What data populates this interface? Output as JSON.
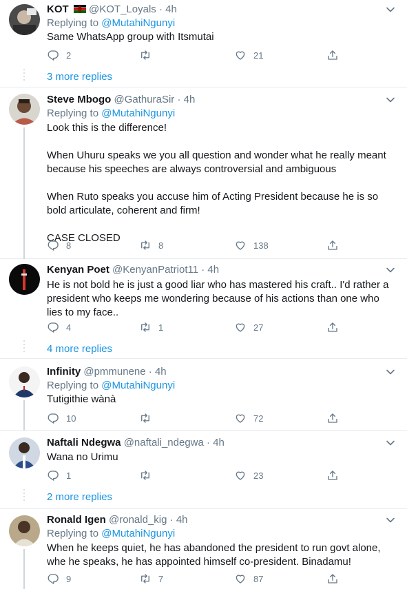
{
  "colors": {
    "link": "#1b95e0",
    "muted": "#657786",
    "text": "#14171a",
    "border": "#e6ecf0"
  },
  "icons": {
    "reply": "reply-icon",
    "retweet": "retweet-icon",
    "like": "heart-icon",
    "share": "share-icon",
    "more": "chevron-down-icon"
  },
  "tweets": [
    {
      "name": "KOT",
      "flag": "kenya-flag-icon",
      "handle": "@KOT_Loyals",
      "dot": "·",
      "time": "4h",
      "replying_prefix": "Replying to ",
      "replying_to": "@MutahiNgunyi",
      "text": "Same WhatsApp group with Itsmutai",
      "replies": "2",
      "retweets": "",
      "likes": "21",
      "more_replies": "3 more replies"
    },
    {
      "name": "Steve Mbogo",
      "handle": "@GathuraSir",
      "dot": "·",
      "time": "4h",
      "replying_prefix": "Replying to ",
      "replying_to": "@MutahiNgunyi",
      "text": "Look this is the difference!\n\nWhen Uhuru speaks we you all question and wonder what he really meant because his speeches are always controversial and ambiguous\n\nWhen Ruto speaks you accuse him of Acting President because he is so bold articulate, coherent and firm!\n\nCASE CLOSED",
      "replies": "8",
      "retweets": "8",
      "likes": "138"
    },
    {
      "name": "Kenyan Poet",
      "handle": "@KenyanPatriot11",
      "dot": "·",
      "time": "4h",
      "text": "He is not bold he is just a good liar who has mastered his craft.. I'd rather a president who keeps me wondering because of his actions than one who lies to my face..",
      "replies": "4",
      "retweets": "1",
      "likes": "27",
      "more_replies": "4 more replies"
    },
    {
      "name": "Infinity",
      "handle": "@pmmunene",
      "dot": "·",
      "time": "4h",
      "replying_prefix": "Replying to ",
      "replying_to": "@MutahiNgunyi",
      "text": "Tutigithie wànà",
      "replies": "10",
      "retweets": "",
      "likes": "72"
    },
    {
      "name": "Naftali Ndegwa",
      "handle": "@naftali_ndegwa",
      "dot": "·",
      "time": "4h",
      "text": "Wana no Urimu",
      "replies": "1",
      "retweets": "",
      "likes": "23",
      "more_replies": "2 more replies"
    },
    {
      "name": "Ronald Igen",
      "handle": "@ronald_kig",
      "dot": "·",
      "time": "4h",
      "replying_prefix": "Replying to ",
      "replying_to": "@MutahiNgunyi",
      "text": "When he keeps quiet, he has abandoned the president to run govt alone, whe he speaks, he has appointed himself co-president. Binadamu!",
      "replies": "9",
      "retweets": "7",
      "likes": "87"
    }
  ]
}
